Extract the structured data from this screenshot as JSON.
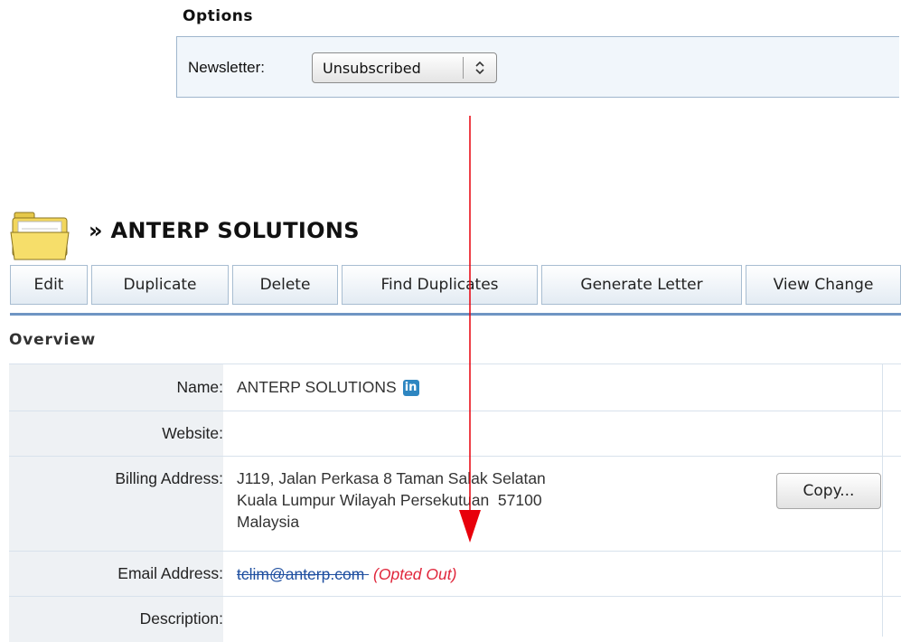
{
  "options": {
    "title": "Options",
    "newsletter_label": "Newsletter:",
    "newsletter_value": "Unsubscribed",
    "arrow_glyph": "⌃⌄"
  },
  "record": {
    "icon": "folder-icon",
    "title": "» ANTERP SOLUTIONS"
  },
  "toolbar": {
    "buttons": [
      "Edit",
      "Duplicate",
      "Delete",
      "Find Duplicates",
      "Generate Letter",
      "View Change"
    ]
  },
  "overview": {
    "heading": "Overview",
    "rows": {
      "name": {
        "label": "Name:",
        "value": "ANTERP SOLUTIONS",
        "icon": "linkedin-icon",
        "icon_text": "in"
      },
      "website": {
        "label": "Website:",
        "value": ""
      },
      "billing": {
        "label": "Billing Address:",
        "lines": [
          "J119, Jalan Perkasa 8 Taman Salak Selatan",
          "Kuala Lumpur Wilayah Persekutuan  57100",
          "Malaysia"
        ],
        "copy_label": "Copy..."
      },
      "email": {
        "label": "Email Address:",
        "value": "tclim@anterp.com",
        "status": "(Opted Out)"
      },
      "description": {
        "label": "Description:",
        "value": ""
      }
    }
  },
  "annotation": {
    "color": "#e8000b"
  }
}
